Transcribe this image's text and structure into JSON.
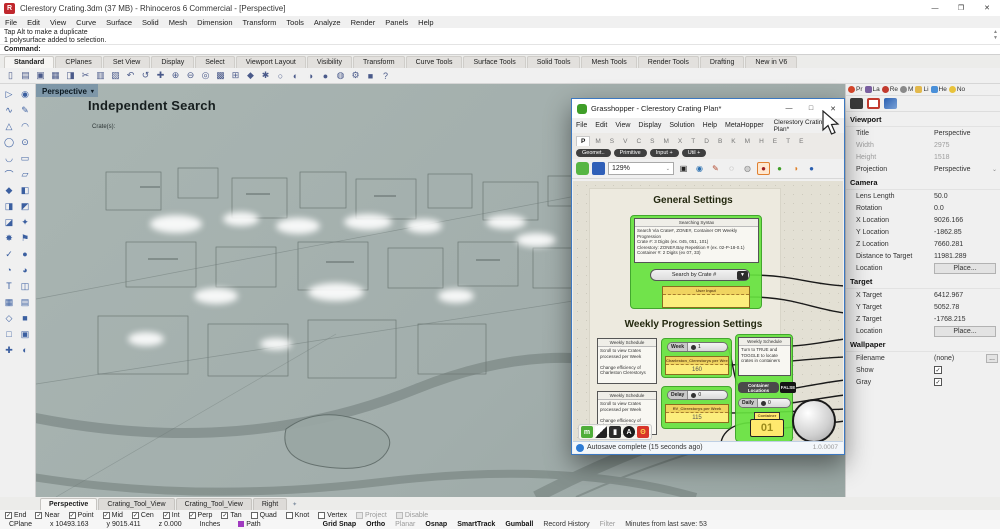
{
  "titlebar": {
    "title": "Clerestory Crating.3dm (37 MB) - Rhinoceros 6 Commercial - [Perspective]",
    "minimize": "—",
    "maximize": "❐",
    "close": "✕"
  },
  "menubar": [
    "File",
    "Edit",
    "View",
    "Curve",
    "Surface",
    "Solid",
    "Mesh",
    "Dimension",
    "Transform",
    "Tools",
    "Analyze",
    "Render",
    "Panels",
    "Help"
  ],
  "command": {
    "line1": "Tap Alt to make a duplicate",
    "line2": "1 polysurface added to selection.",
    "prompt": "Command:"
  },
  "toolbar_tabs": [
    {
      "label": "Standard",
      "active": true
    },
    {
      "label": "CPlanes"
    },
    {
      "label": "Set View"
    },
    {
      "label": "Display"
    },
    {
      "label": "Select"
    },
    {
      "label": "Viewport Layout"
    },
    {
      "label": "Visibility"
    },
    {
      "label": "Transform"
    },
    {
      "label": "Curve Tools"
    },
    {
      "label": "Surface Tools"
    },
    {
      "label": "Solid Tools"
    },
    {
      "label": "Mesh Tools"
    },
    {
      "label": "Render Tools"
    },
    {
      "label": "Drafting"
    },
    {
      "label": "New in V6"
    }
  ],
  "main_toolbar_icons": [
    {
      "glyph": "▯"
    },
    {
      "glyph": "▤"
    },
    {
      "glyph": "▣"
    },
    {
      "glyph": "▦"
    },
    {
      "glyph": "◨"
    },
    {
      "glyph": "✂"
    },
    {
      "glyph": "▥"
    },
    {
      "glyph": "▧"
    },
    {
      "glyph": "↶"
    },
    {
      "glyph": "↺"
    },
    {
      "glyph": "✚"
    },
    {
      "glyph": "⊕"
    },
    {
      "glyph": "⊖"
    },
    {
      "glyph": "◎"
    },
    {
      "glyph": "▩"
    },
    {
      "glyph": "⊞"
    },
    {
      "glyph": "◆"
    },
    {
      "glyph": "✱"
    },
    {
      "glyph": "○"
    },
    {
      "glyph": "◐"
    },
    {
      "glyph": "◑"
    },
    {
      "glyph": "●"
    },
    {
      "glyph": "◍"
    },
    {
      "glyph": "⚙"
    },
    {
      "glyph": "■"
    },
    {
      "glyph": "?"
    }
  ],
  "sidebar_tools": [
    {
      "glyph": "▷"
    },
    {
      "glyph": "◉"
    },
    {
      "glyph": "∿"
    },
    {
      "glyph": "✎"
    },
    {
      "glyph": "△"
    },
    {
      "glyph": "◠"
    },
    {
      "glyph": "◯"
    },
    {
      "glyph": "⊙"
    },
    {
      "glyph": "◡"
    },
    {
      "glyph": "▭"
    },
    {
      "glyph": "⌒"
    },
    {
      "glyph": "▱"
    },
    {
      "glyph": "◆"
    },
    {
      "glyph": "◧"
    },
    {
      "glyph": "◨"
    },
    {
      "glyph": "◩"
    },
    {
      "glyph": "◪"
    },
    {
      "glyph": "✦"
    },
    {
      "glyph": "✸"
    },
    {
      "glyph": "⚑"
    },
    {
      "glyph": "✓"
    },
    {
      "glyph": "●"
    },
    {
      "glyph": "◔"
    },
    {
      "glyph": "◕"
    },
    {
      "glyph": "T"
    },
    {
      "glyph": "◫"
    },
    {
      "glyph": "▦"
    },
    {
      "glyph": "▤"
    },
    {
      "glyph": "◇"
    },
    {
      "glyph": "■"
    },
    {
      "glyph": "□"
    },
    {
      "glyph": "▣"
    },
    {
      "glyph": "✚"
    },
    {
      "glyph": "◐"
    }
  ],
  "viewport": {
    "tab": "Perspective",
    "dropdown_glyph": "▾",
    "heading": "Independent Search",
    "subheading": "Crate(s):"
  },
  "grasshopper": {
    "title": "Grasshopper - Clerestory Crating Plan*",
    "buttons": {
      "minimize": "—",
      "maximize": "□",
      "close": "✕"
    },
    "menus": [
      "File",
      "Edit",
      "View",
      "Display",
      "Solution",
      "Help",
      "MetaHopper"
    ],
    "doc_tab": "Clerestory Crating Plan*",
    "component_tabs": [
      {
        "label": "P",
        "active": true
      },
      {
        "label": "M"
      },
      {
        "label": "S"
      },
      {
        "label": "V"
      },
      {
        "label": "C"
      },
      {
        "label": "S"
      },
      {
        "label": "M"
      },
      {
        "label": "X"
      },
      {
        "label": "T"
      },
      {
        "label": "D"
      },
      {
        "label": "B"
      },
      {
        "label": "K"
      },
      {
        "label": "M"
      },
      {
        "label": "H"
      },
      {
        "label": "E"
      },
      {
        "label": "T"
      },
      {
        "label": "E"
      }
    ],
    "category_pills": [
      {
        "label": "Geomet.."
      },
      {
        "label": "Primitive"
      },
      {
        "label": "Input +"
      },
      {
        "label": "Util +"
      }
    ],
    "zoom_level": "129%",
    "general": {
      "heading": "General Settings",
      "panel_title": "Searching Syntax",
      "panel_text": "Search Via Crate#, ZONE#, Container OR Weekly Progression\nCrate #: 3 Digits (ex. 045, 051, 101)\nClerestory: ZONE#.Bay Repetition # (ex. 02-P-18-0.1)\nContainer #: 2 Digits (ex 07, 33)",
      "dropdown_label": "Search by Crate #",
      "funnel_glyph": "▼",
      "user_input_title": "User Input"
    },
    "weekly": {
      "heading": "Weekly Progression Settings",
      "note1_title": "Weekly Schedule",
      "note1_text": "Scroll to view Crates processed per Week\n\nChange efficiency of Charleston Clerestorys",
      "note2_title": "Weekly Schedule",
      "note2_text": "Scroll to view Crates processed per Week\n\nChange efficiency of Charleston Clerestorys",
      "week_slider": {
        "label": "Week",
        "value": "1"
      },
      "charleston_panel": {
        "title": "Charleston_Clerestorys per Week",
        "value": "160"
      },
      "delay_slider": {
        "label": "Delay",
        "value": "0"
      },
      "rv_panel": {
        "title": "RV_Clerestorys per Week",
        "value": "115"
      },
      "note3_title": "Weekly Schedule",
      "note3_text": "Turn to TRUE and TOGGLE to locate crates in containers",
      "container_button": {
        "label": "Container Locations",
        "state": "FALSE"
      },
      "daily_slider": {
        "label": "Daily",
        "value": "0"
      },
      "counter": {
        "title": "Container",
        "value": "01"
      }
    },
    "statusbar": {
      "message": "Autosave complete (15 seconds ago)",
      "version": "1.0.0007"
    }
  },
  "properties": {
    "tabs": {
      "pr": "Pr",
      "la": "La",
      "re": "Re",
      "ma": "M",
      "li": "Li",
      "he": "He",
      "no": "No"
    },
    "viewport": {
      "header": "Viewport",
      "title_label": "Title",
      "title_value": "Perspective",
      "width_label": "Width",
      "width_value": "2975",
      "height_label": "Height",
      "height_value": "1518",
      "projection_label": "Projection",
      "projection_value": "Perspective"
    },
    "camera": {
      "header": "Camera",
      "rows": [
        {
          "label": "Lens Length",
          "value": "50.0"
        },
        {
          "label": "Rotation",
          "value": "0.0"
        },
        {
          "label": "X Location",
          "value": "9026.166"
        },
        {
          "label": "Y Location",
          "value": "-1862.85"
        },
        {
          "label": "Z Location",
          "value": "7660.281"
        },
        {
          "label": "Distance to Target",
          "value": "11981.289"
        }
      ],
      "location_label": "Location",
      "place_button": "Place..."
    },
    "target": {
      "header": "Target",
      "rows": [
        {
          "label": "X Target",
          "value": "6412.967"
        },
        {
          "label": "Y Target",
          "value": "5052.78"
        },
        {
          "label": "Z Target",
          "value": "-1768.215"
        }
      ],
      "location_label": "Location",
      "place_button": "Place..."
    },
    "wallpaper": {
      "header": "Wallpaper",
      "filename_label": "Filename",
      "filename_value": "(none)",
      "browse": "...",
      "show_label": "Show",
      "gray_label": "Gray"
    }
  },
  "bottom": {
    "viewport_tabs": [
      {
        "label": "Perspective",
        "active": true
      },
      {
        "label": "Crating_Tool_View"
      },
      {
        "label": "Crating_Tool_View"
      },
      {
        "label": "Right"
      }
    ],
    "osnap": [
      {
        "label": "End",
        "checked": true
      },
      {
        "label": "Near",
        "checked": true
      },
      {
        "label": "Point",
        "checked": true
      },
      {
        "label": "Mid",
        "checked": true
      },
      {
        "label": "Cen",
        "checked": true
      },
      {
        "label": "Int",
        "checked": true
      },
      {
        "label": "Perp",
        "checked": true
      },
      {
        "label": "Tan",
        "checked": true
      },
      {
        "label": "Quad"
      },
      {
        "label": "Knot"
      },
      {
        "label": "Vertex"
      },
      {
        "label": "Project",
        "disabled": true
      },
      {
        "label": "Disable",
        "disabled": true
      }
    ],
    "status_cells": [
      {
        "label": "CPlane"
      },
      {
        "label": "x 10493.163"
      },
      {
        "label": "y 9015.411"
      },
      {
        "label": "z 0.000"
      },
      {
        "label": "Inches"
      }
    ],
    "path_label": "Path",
    "toggles": [
      {
        "label": "Grid Snap",
        "bold": true
      },
      {
        "label": "Ortho",
        "bold": true
      },
      {
        "label": "Planar",
        "muted": true
      },
      {
        "label": "Osnap",
        "bold": true
      },
      {
        "label": "SmartTrack",
        "bold": true
      },
      {
        "label": "Gumball",
        "bold": true
      },
      {
        "label": "Record History"
      },
      {
        "label": "Filter",
        "muted": true
      },
      {
        "label": "Minutes from last save: 53"
      }
    ]
  }
}
